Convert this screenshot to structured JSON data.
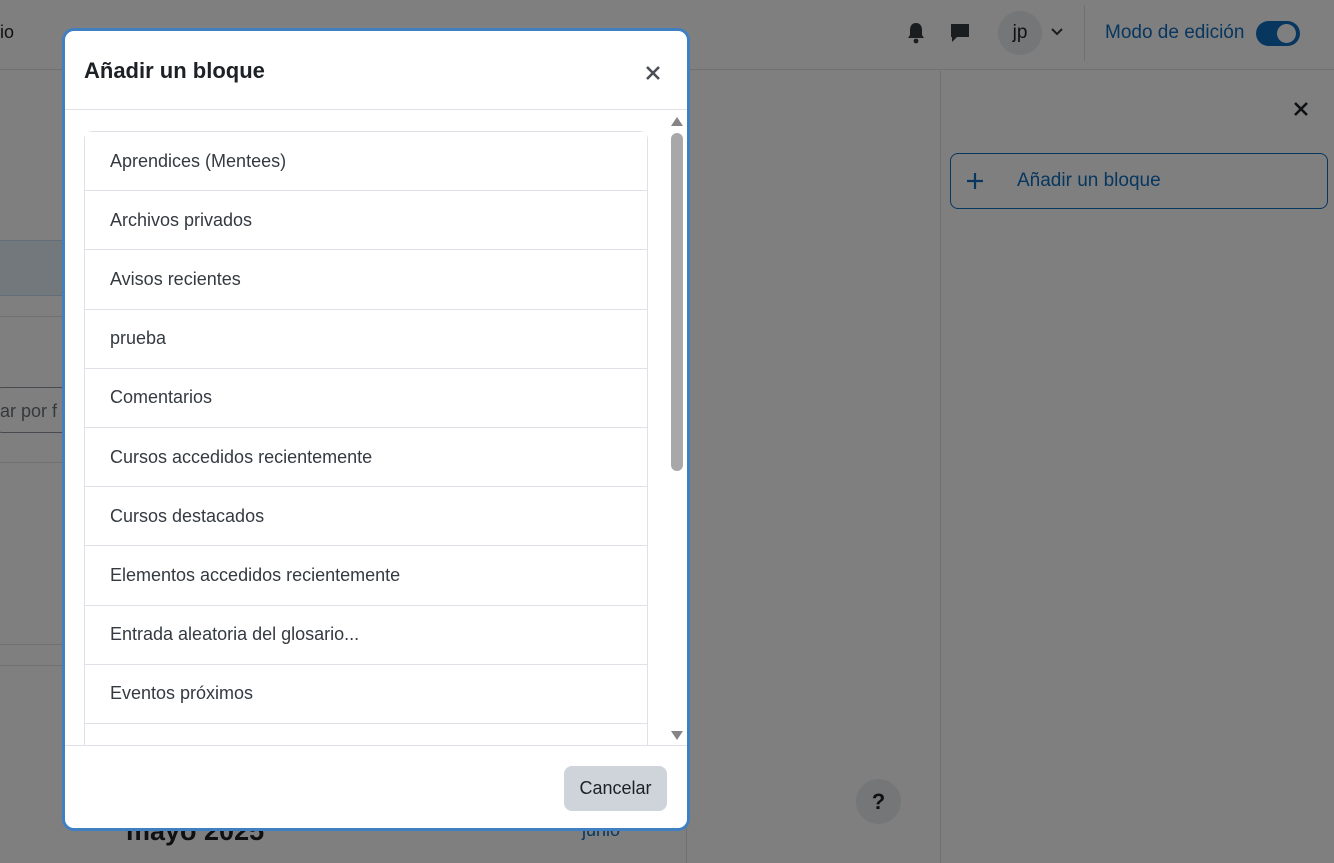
{
  "navbar": {
    "partial_left_text": "io",
    "icons": {
      "notifications": "bell-icon",
      "messages": "chat-icon",
      "user_menu": "chevron-down-icon"
    },
    "avatar_initials": "jp",
    "edit_mode_label": "Modo de edición",
    "edit_mode_on": true
  },
  "drawer": {
    "close_icon": "close-icon",
    "add_block_label": "Añadir un bloque",
    "add_block_icon": "plus-icon"
  },
  "background": {
    "search_placeholder_partial": "ar por f",
    "calendar_month": "mayo 2025",
    "calendar_next": "junio",
    "help_label": "?"
  },
  "modal": {
    "title": "Añadir un bloque",
    "close_icon": "close-icon",
    "items": [
      {
        "label": "Aprendices (Mentees)"
      },
      {
        "label": "Archivos privados"
      },
      {
        "label": "Avisos recientes"
      },
      {
        "label": "prueba"
      },
      {
        "label": "Comentarios"
      },
      {
        "label": "Cursos accedidos recientemente"
      },
      {
        "label": "Cursos destacados"
      },
      {
        "label": "Elementos accedidos recientemente"
      },
      {
        "label": "Entrada aleatoria del glosario..."
      },
      {
        "label": "Eventos próximos"
      },
      {
        "label": ""
      }
    ],
    "cancel_label": "Cancelar"
  },
  "colors": {
    "accent": "#0f6cbf",
    "modal_border": "#3f7fc2",
    "backdrop": "rgba(0,0,0,0.5)"
  }
}
